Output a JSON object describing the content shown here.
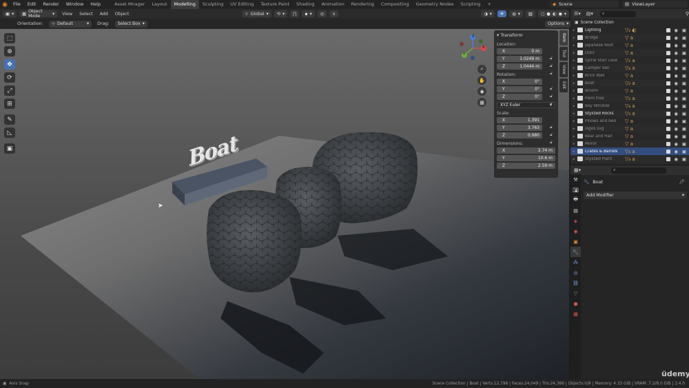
{
  "menu": {
    "file": "File",
    "edit": "Edit",
    "render": "Render",
    "window": "Window",
    "help": "Help"
  },
  "workspaces": [
    "Asset Mnager",
    "Layout",
    "Modelling",
    "Sculpting",
    "UV Editing",
    "Texture Paint",
    "Shading",
    "Animation",
    "Rendering",
    "Compositing",
    "Geometry Nodes",
    "Scripting"
  ],
  "active_workspace": "Modelling",
  "add_tab": "+",
  "scene": {
    "label": "Scene",
    "view_layer": "ViewLayer"
  },
  "header": {
    "mode": "Object Mode",
    "view": "View",
    "select": "Select",
    "add": "Add",
    "object": "Object",
    "transform_orientation": "Global"
  },
  "toolrow": {
    "orientation_label": "Orientation:",
    "orientation_value": "Default",
    "drag_label": "Drag:",
    "drag_value": "Select Box",
    "options": "Options"
  },
  "transform_panel": {
    "title": "Transform",
    "location_label": "Location:",
    "location": [
      {
        "axis": "X",
        "value": "0 m"
      },
      {
        "axis": "Y",
        "value": "1.0249 m"
      },
      {
        "axis": "Z",
        "value": "1.0444 m"
      }
    ],
    "rotation_label": "Rotation:",
    "rotation": [
      {
        "axis": "X",
        "value": "0°"
      },
      {
        "axis": "Y",
        "value": "0°"
      },
      {
        "axis": "Z",
        "value": "0°"
      }
    ],
    "rotation_mode": "XYZ Euler",
    "scale_label": "Scale:",
    "scale": [
      {
        "axis": "X",
        "value": "1.391"
      },
      {
        "axis": "Y",
        "value": "3.763"
      },
      {
        "axis": "Z",
        "value": "0.980"
      }
    ],
    "dimensions_label": "Dimensions:",
    "dimensions": [
      {
        "axis": "X",
        "value": "2.74 m"
      },
      {
        "axis": "Y",
        "value": "10.6 m"
      },
      {
        "axis": "Z",
        "value": "2.59 m"
      }
    ]
  },
  "sidebar_tabs": [
    "Item",
    "Tool",
    "View",
    "Edit"
  ],
  "gizmo": {
    "x": "X",
    "y": "Y",
    "z": "Z"
  },
  "outliner": {
    "root": "Scene Collection",
    "items": [
      {
        "name": "Lighting",
        "extra": "▽₂ ◐",
        "bright": true,
        "selected": false
      },
      {
        "name": "Bridge",
        "extra": "▽ a",
        "bright": false,
        "selected": false
      },
      {
        "name": "Japanese Roof",
        "extra": "▽ a",
        "bright": false,
        "selected": false
      },
      {
        "name": "Door",
        "extra": "▽ a",
        "bright": false,
        "selected": false
      },
      {
        "name": "Spiral Stair case",
        "extra": "▽₂ a",
        "bright": false,
        "selected": false
      },
      {
        "name": "Camper Van",
        "extra": "▽₄ a",
        "bright": false,
        "selected": false
      },
      {
        "name": "Brick Wall",
        "extra": "▽ a",
        "bright": false,
        "selected": false
      },
      {
        "name": "Boat",
        "extra": "▽₂ a",
        "bright": false,
        "selected": false
      },
      {
        "name": "Broom",
        "extra": "▽ a",
        "bright": false,
        "selected": false
      },
      {
        "name": "Palm tree",
        "extra": "▽₂ a",
        "bright": false,
        "selected": false
      },
      {
        "name": "Bay Window",
        "extra": "▽₄ a",
        "bright": false,
        "selected": false
      },
      {
        "name": "Stylized Rocks",
        "extra": "▽₃ a",
        "bright": true,
        "selected": false
      },
      {
        "name": "Pillows and bed",
        "extra": "▽ a",
        "bright": false,
        "selected": false
      },
      {
        "name": "logos svg",
        "extra": "▽ a",
        "bright": false,
        "selected": false
      },
      {
        "name": "Bear and Hair",
        "extra": "▽ a",
        "bright": false,
        "selected": false
      },
      {
        "name": "Mirror",
        "extra": "▽ a",
        "bright": false,
        "selected": false
      },
      {
        "name": "Crates & Barrels",
        "extra": "▽₄ a",
        "bright": false,
        "selected": true
      },
      {
        "name": "Stylized Plant",
        "extra": "▽₃ a",
        "bright": false,
        "selected": false
      }
    ]
  },
  "properties": {
    "object_name": "Boat",
    "add_modifier": "Add Modifier"
  },
  "status": {
    "left": "Axis Snap",
    "right": "Scene Collection | Boat | Verts:12,796 | Faces:24,049 | Tris:24,366 | Objects:0/8 | Memory: 4.33 GiB | VRAM: 7.2/8.0 GiB | 3.4.0"
  },
  "watermark": "üdemy",
  "sign_text": "Boat",
  "colors": {
    "accent": "#4772b3",
    "selected_row": "#334d80",
    "orange": "#e8852b"
  }
}
